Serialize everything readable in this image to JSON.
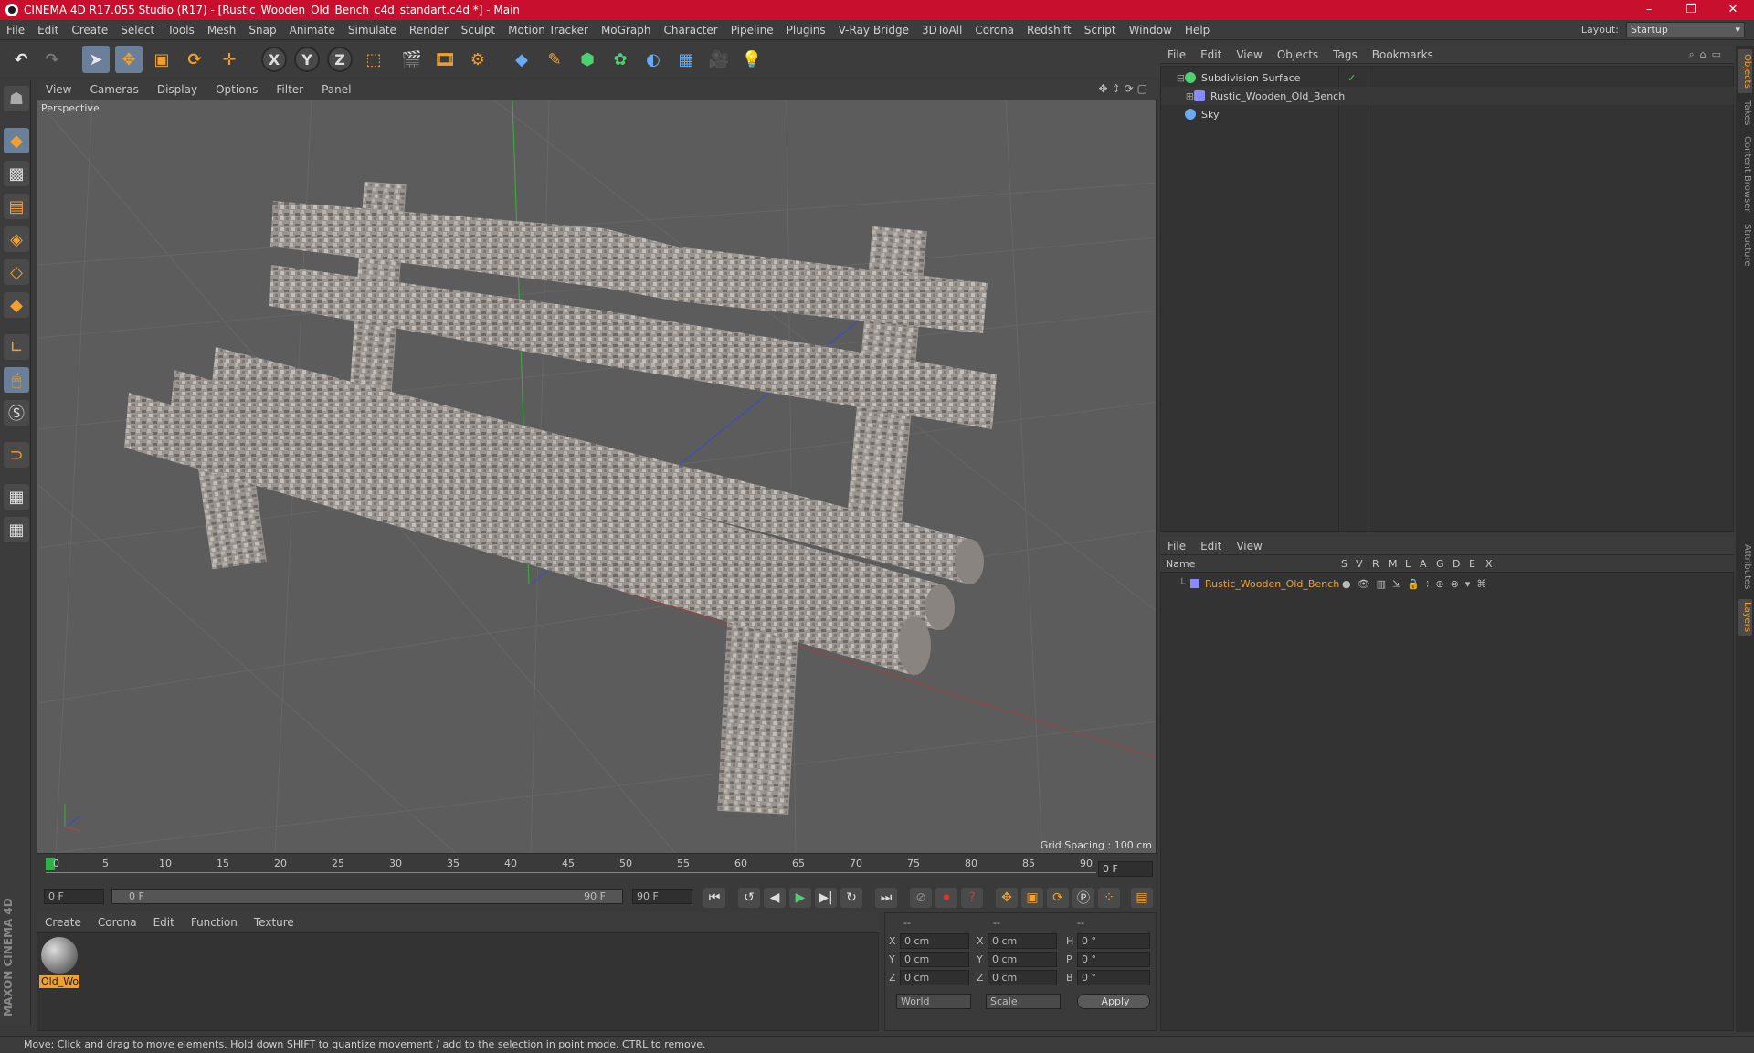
{
  "window": {
    "title": "CINEMA 4D R17.055 Studio (R17) - [Rustic_Wooden_Old_Bench_c4d_standart.c4d *] - Main",
    "minimize": "–",
    "restore": "❐",
    "close": "✕"
  },
  "menubar": {
    "items": [
      "File",
      "Edit",
      "Create",
      "Select",
      "Tools",
      "Mesh",
      "Snap",
      "Animate",
      "Simulate",
      "Render",
      "Sculpt",
      "Motion Tracker",
      "MoGraph",
      "Character",
      "Pipeline",
      "Plugins",
      "V-Ray Bridge",
      "3DToAll",
      "Corona",
      "Redshift",
      "Script",
      "Window",
      "Help"
    ],
    "layout_label": "Layout:",
    "layout_value": "Startup"
  },
  "toolbar": {
    "axis_x": "X",
    "axis_y": "Y",
    "axis_z": "Z"
  },
  "viewport": {
    "menu": [
      "View",
      "Cameras",
      "Display",
      "Options",
      "Filter",
      "Panel"
    ],
    "camera_label": "Perspective",
    "grid_spacing": "Grid Spacing : 100 cm"
  },
  "timeline": {
    "ticks": [
      "0",
      "5",
      "10",
      "15",
      "20",
      "25",
      "30",
      "35",
      "40",
      "45",
      "50",
      "55",
      "60",
      "65",
      "70",
      "75",
      "80",
      "85",
      "90"
    ],
    "current_frame": "0 F",
    "start_field": "0 F",
    "range_start": "0 F",
    "range_end": "90 F",
    "end_field": "90 F"
  },
  "material_manager": {
    "menu": [
      "Create",
      "Corona",
      "Edit",
      "Function",
      "Texture"
    ],
    "materials": [
      {
        "name": "Old_Wo"
      }
    ]
  },
  "coordinates": {
    "headers": [
      "--",
      "--",
      "--"
    ],
    "rows": [
      {
        "a_label": "X",
        "a_value": "0 cm",
        "b_label": "X",
        "b_value": "0 cm",
        "c_label": "H",
        "c_value": "0 °"
      },
      {
        "a_label": "Y",
        "a_value": "0 cm",
        "b_label": "Y",
        "b_value": "0 cm",
        "c_label": "P",
        "c_value": "0 °"
      },
      {
        "a_label": "Z",
        "a_value": "0 cm",
        "b_label": "Z",
        "b_value": "0 cm",
        "c_label": "B",
        "c_value": "0 °"
      }
    ],
    "mode_select": "World",
    "scale_select": "Scale",
    "apply": "Apply"
  },
  "object_manager": {
    "menu": [
      "File",
      "Edit",
      "View",
      "Objects",
      "Tags",
      "Bookmarks"
    ],
    "objects": [
      {
        "name": "Subdivision Surface",
        "color": "#4cd070"
      },
      {
        "name": "Rustic_Wooden_Old_Bench",
        "color": "#8a8aff"
      },
      {
        "name": "Sky",
        "color": "#6aaaf0"
      }
    ]
  },
  "layer_manager": {
    "menu": [
      "File",
      "Edit",
      "View"
    ],
    "columns": [
      "Name",
      "S",
      "V",
      "R",
      "M",
      "L",
      "A",
      "G",
      "D",
      "E",
      "X"
    ],
    "layers": [
      {
        "name": "Rustic_Wooden_Old_Bench",
        "color": "#f0a030"
      }
    ]
  },
  "side_tabs": [
    "Objects",
    "Takes",
    "Content Browser",
    "Structure",
    "Attributes",
    "Layers"
  ],
  "brand": "MAXON CINEMA 4D",
  "status": "Move: Click and drag to move elements. Hold down SHIFT to quantize movement / add to the selection in point mode, CTRL to remove.",
  "colors": {
    "title_bar": "#c8102e",
    "accent": "#f0a030",
    "selection": "#6a7f9a",
    "viewport_bg": "#5c5c5c"
  }
}
